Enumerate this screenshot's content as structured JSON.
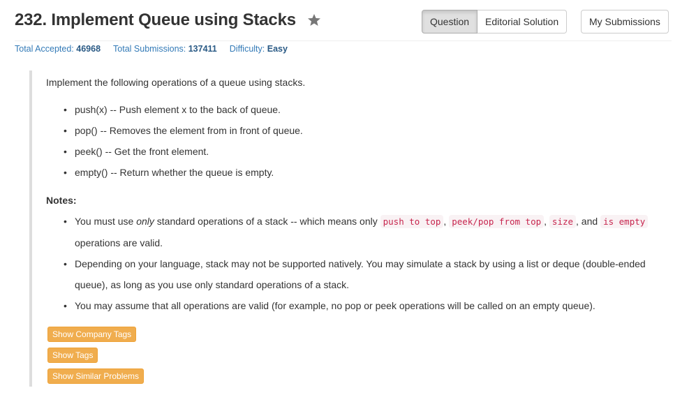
{
  "title": "232. Implement Queue using Stacks",
  "buttons": {
    "question": "Question",
    "editorial": "Editorial Solution",
    "submissions": "My Submissions"
  },
  "stats": {
    "accepted_label": "Total Accepted:",
    "accepted_value": "46968",
    "submissions_label": "Total Submissions:",
    "submissions_value": "137411",
    "difficulty_label": "Difficulty:",
    "difficulty_value": "Easy"
  },
  "intro": "Implement the following operations of a queue using stacks.",
  "operations": [
    "push(x) -- Push element x to the back of queue.",
    "pop() -- Removes the element from in front of queue.",
    "peek() -- Get the front element.",
    "empty() -- Return whether the queue is empty."
  ],
  "notes_heading": "Notes:",
  "note1": {
    "prefix": "You must use ",
    "emph": "only",
    "middle": " standard operations of a stack -- which means only ",
    "code1": "push to top",
    "sep1": ", ",
    "code2": "peek/pop from top",
    "sep2": ", ",
    "code3": "size",
    "sep3": ", and ",
    "code4": "is empty",
    "suffix": " operations are valid."
  },
  "note2": "Depending on your language, stack may not be supported natively. You may simulate a stack by using a list or deque (double-ended queue), as long as you use only standard operations of a stack.",
  "note3": "You may assume that all operations are valid (for example, no pop or peek operations will be called on an empty queue).",
  "tag_buttons": {
    "company": "Show Company Tags",
    "tags": "Show Tags",
    "similar": "Show Similar Problems"
  },
  "icons": {
    "star": "star-icon"
  },
  "colors": {
    "accent": "#337ab7",
    "tag_button": "#f0ad4e",
    "code": "#c7254e"
  }
}
